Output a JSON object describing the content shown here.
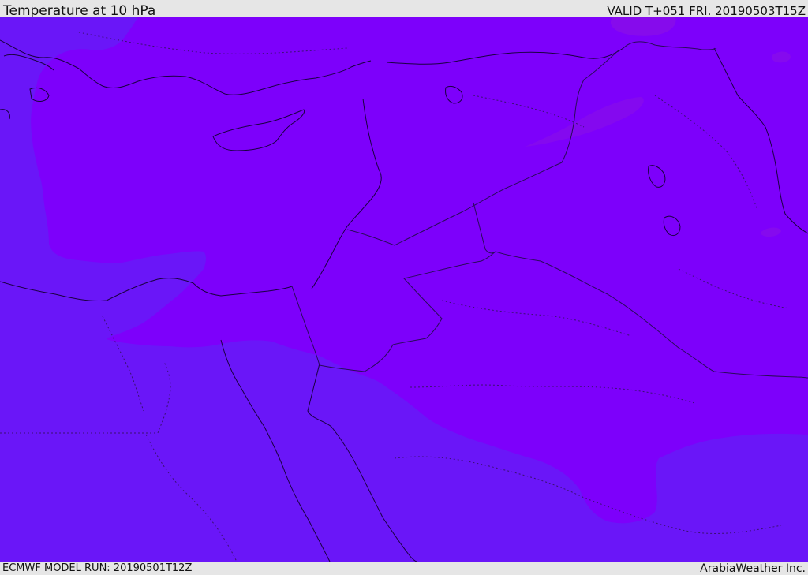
{
  "header": {
    "title": "Temperature at 10 hPa",
    "valid_time": "VALID T+051 FRI. 20190503T15Z"
  },
  "footer": {
    "model_run": "ECMWF MODEL RUN: 20190501T12Z",
    "credit": "ArabiaWeather Inc."
  },
  "map": {
    "field": "temperature",
    "level": "10 hPa",
    "colors": {
      "warm_band": "#7d00fb",
      "cool_band": "#6a16f8",
      "warmest_patch": "#8a10e6",
      "coastline": "#1a0040",
      "border": "#2a0a5a"
    },
    "icons": {
      "contour_fill": "filled-contour",
      "coastline": "coastline-line",
      "country_border": "border-line"
    }
  }
}
